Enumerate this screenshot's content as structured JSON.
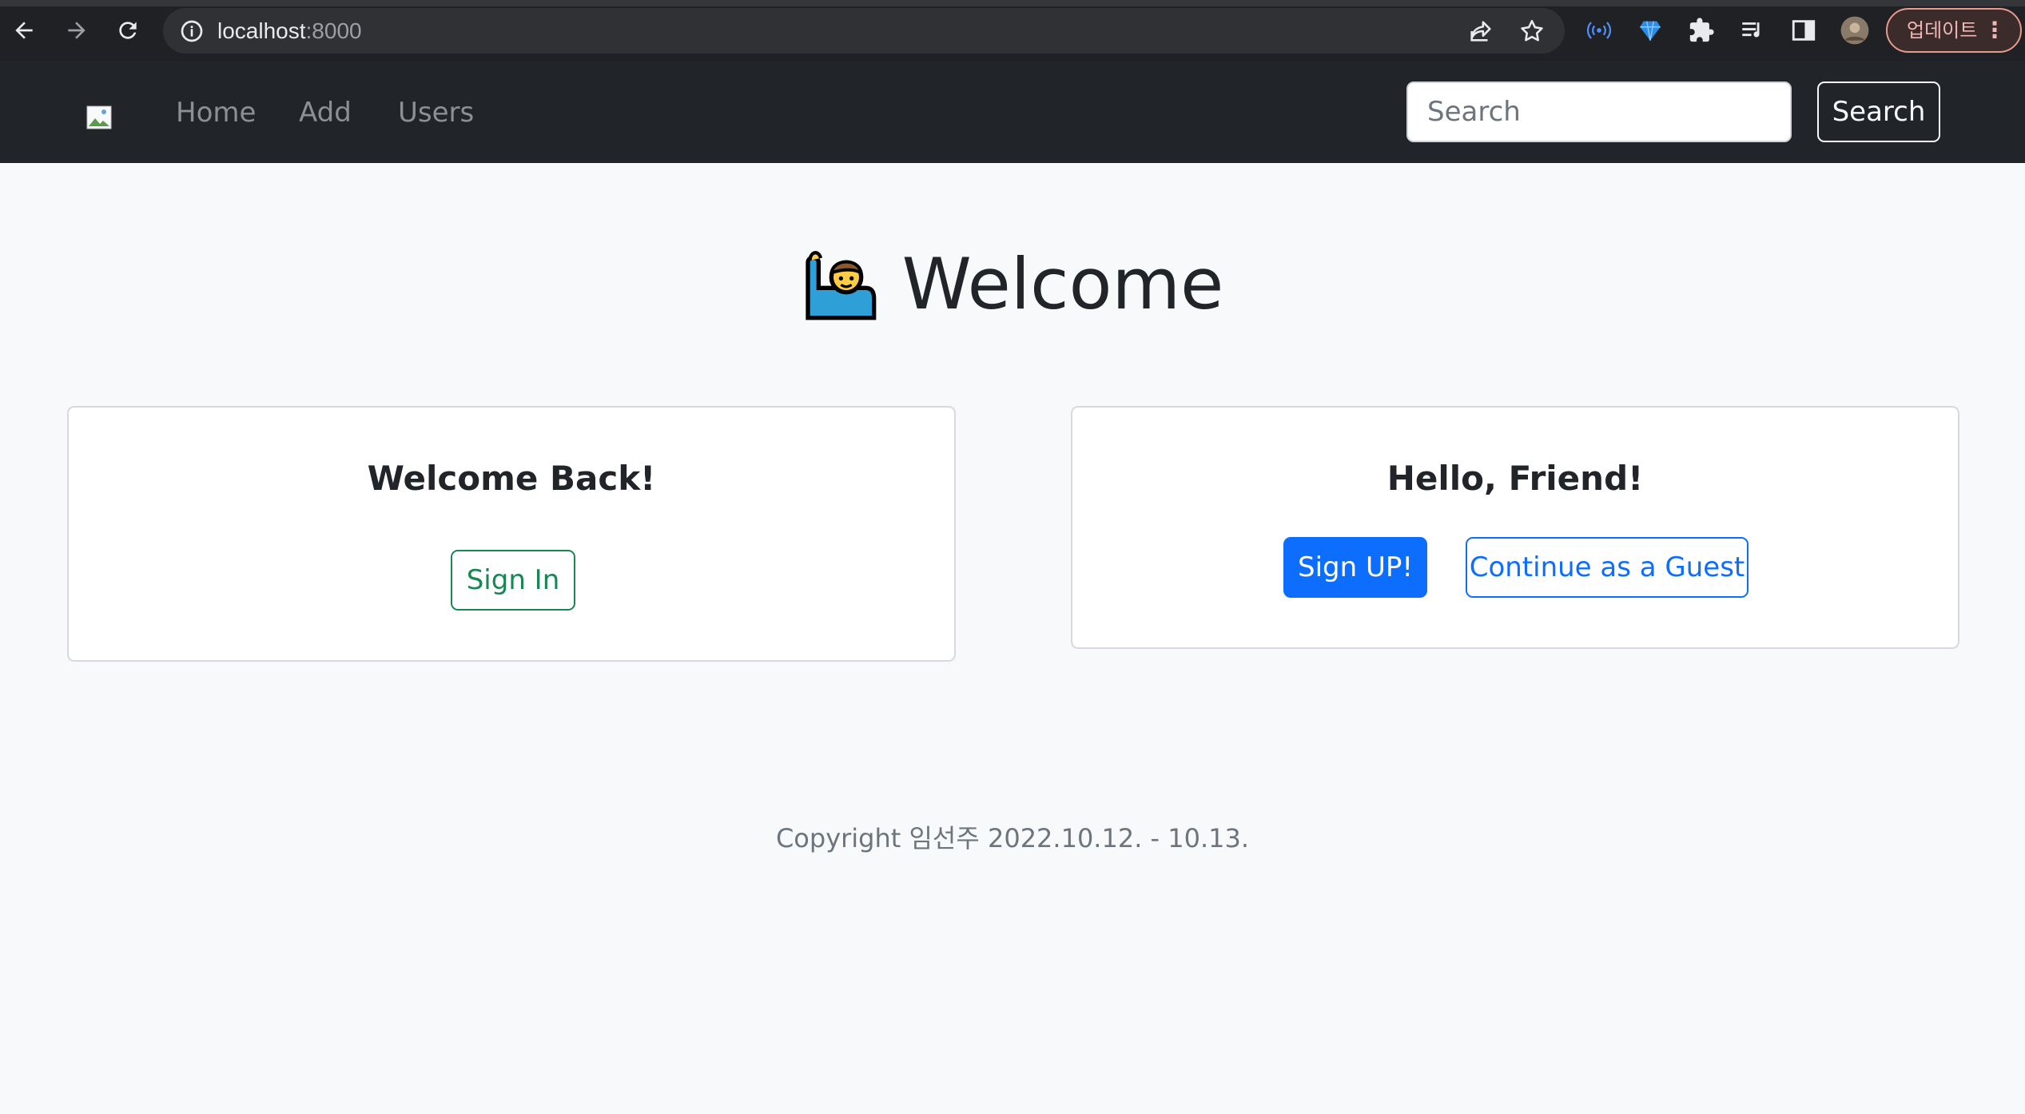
{
  "browser": {
    "url_host": "localhost",
    "url_port": ":8000",
    "update_label": "업데이트",
    "menu_glyph": "⋮"
  },
  "navbar": {
    "links": [
      "Home",
      "Add",
      "Users"
    ],
    "search_placeholder": "Search",
    "search_button": "Search"
  },
  "main": {
    "title": "Welcome",
    "title_emoji_icon": "person-raising-hand-icon",
    "card_signin": {
      "title": "Welcome Back!",
      "button": "Sign In"
    },
    "card_signup": {
      "title": "Hello, Friend!",
      "signup_button": "Sign UP!",
      "guest_button": "Continue as a Guest"
    }
  },
  "footer": {
    "text": "Copyright 임선주 2022.10.12. - 10.13."
  },
  "colors": {
    "navbar_bg": "#212529",
    "primary": "#0d6efd",
    "success": "#198754",
    "page_bg": "#f8f9fa"
  }
}
